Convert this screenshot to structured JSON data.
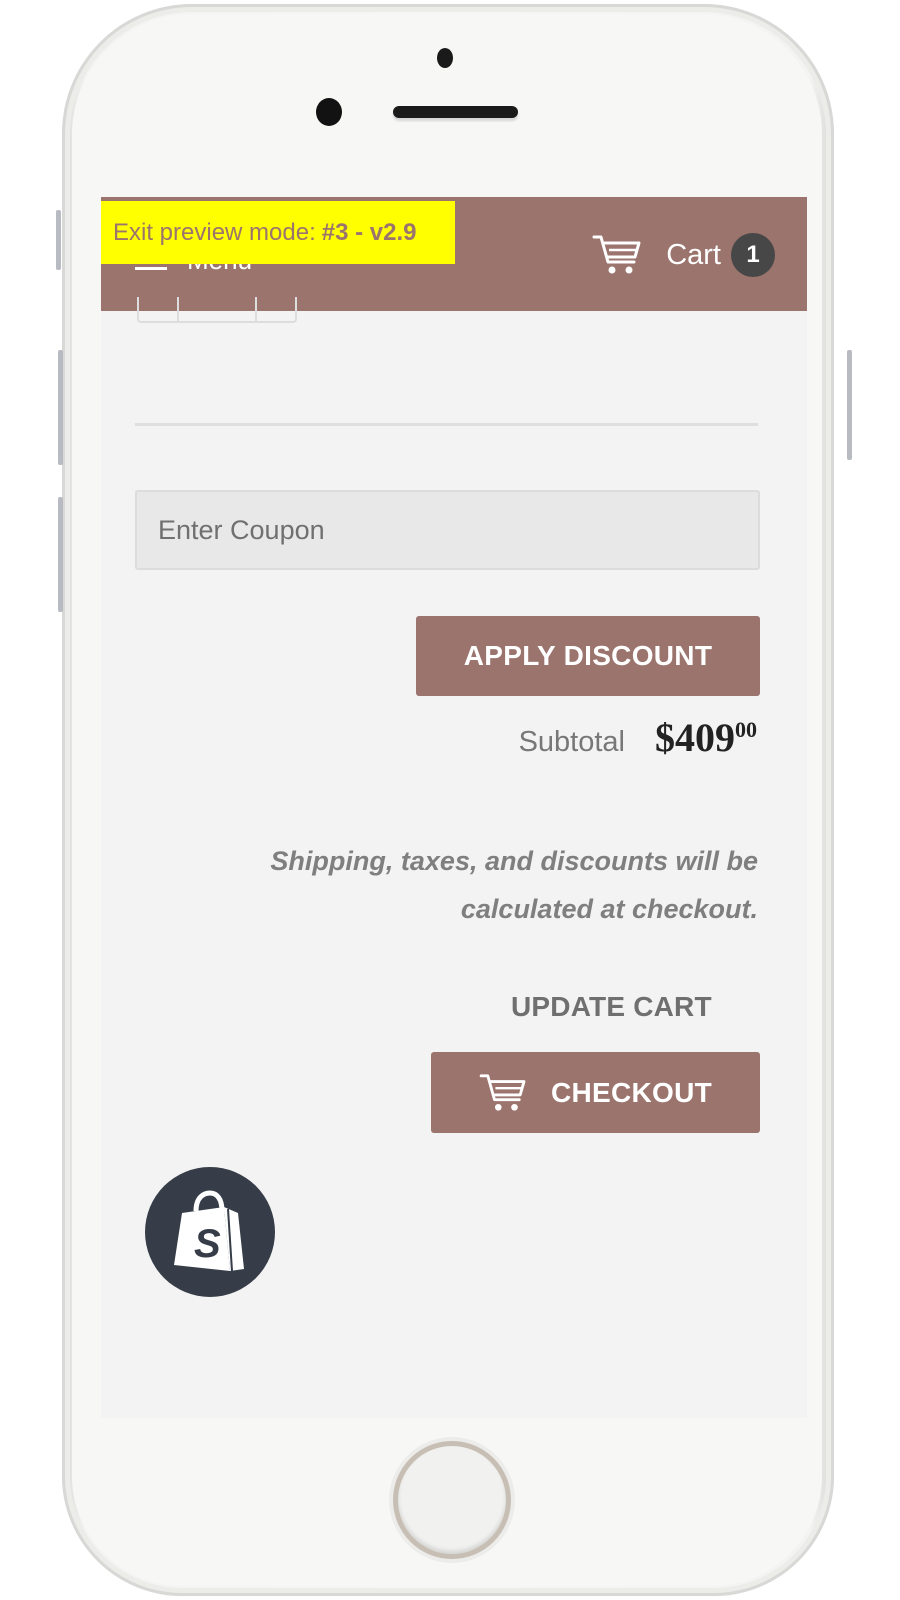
{
  "preview_bar": {
    "prefix": "Exit preview mode:",
    "theme": "#3 - v2.9"
  },
  "header": {
    "menu_label": "Menu",
    "cart_label": "Cart",
    "cart_count": "1",
    "brand_color": "#9b746d"
  },
  "cart": {
    "coupon_placeholder": "Enter Coupon",
    "coupon_value": "",
    "apply_label": "APPLY DISCOUNT",
    "subtotal_label": "Subtotal",
    "subtotal_dollars": "$409",
    "subtotal_cents": "00",
    "shipping_note": "Shipping, taxes, and discounts will be calculated at checkout.",
    "update_label": "UPDATE CART",
    "checkout_label": "CHECKOUT"
  },
  "icons": {
    "cart": "shopping-cart-icon",
    "menu": "hamburger-icon",
    "shopify": "shopify-bag-icon"
  }
}
